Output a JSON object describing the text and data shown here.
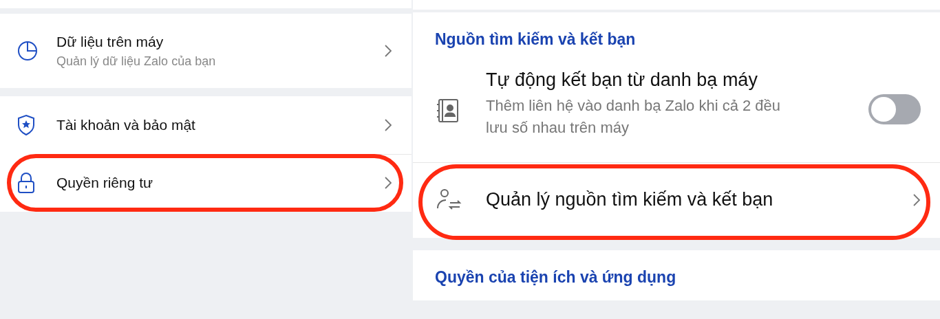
{
  "left_panel": {
    "groups": [
      {
        "items": [
          {
            "title": "Dữ liệu trên máy",
            "subtitle": "Quản lý dữ liệu Zalo của bạn",
            "highlighted": false
          }
        ]
      },
      {
        "items": [
          {
            "title": "Tài khoản và bảo mật",
            "highlighted": false
          },
          {
            "title": "Quyền riêng tư",
            "highlighted": true
          }
        ]
      }
    ]
  },
  "right_panel": {
    "sections": [
      {
        "header": "Nguồn tìm kiếm và kết bạn",
        "items": [
          {
            "kind": "toggle",
            "title": "Tự động kết bạn từ danh bạ máy",
            "subtitle": "Thêm liên hệ vào danh bạ Zalo khi cả 2 đều lưu số nhau trên máy",
            "on": false
          },
          {
            "kind": "link",
            "title": "Quản lý nguồn tìm kiếm và kết bạn",
            "highlighted": true
          }
        ]
      },
      {
        "header": "Quyền của tiện ích và ứng dụng"
      }
    ]
  }
}
